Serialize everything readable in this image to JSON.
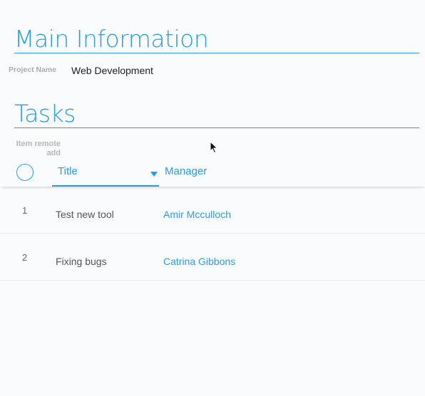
{
  "main_information": {
    "title": "Main Information",
    "project_name_label": "Project Name",
    "project_name_value": "Web Development"
  },
  "tasks": {
    "title": "Tasks",
    "item_remote_add_label": "Item remote add",
    "columns": {
      "title": "Title",
      "manager": "Manager"
    },
    "sort": {
      "column": "Title",
      "direction": "descending"
    },
    "rows": [
      {
        "number": "1",
        "title": "Test new tool",
        "manager": "Amir Mcculloch"
      },
      {
        "number": "2",
        "title": "Fixing bugs",
        "manager": "Catrina Gibbons"
      }
    ]
  },
  "colors": {
    "accent": "#2a9de0",
    "background": "#fafbfc",
    "label_gray": "#a9adb3"
  },
  "icons": {
    "select_all": "circle-checkbox-icon",
    "sort": "caret-down-icon",
    "pointer": "mouse-pointer-icon"
  }
}
